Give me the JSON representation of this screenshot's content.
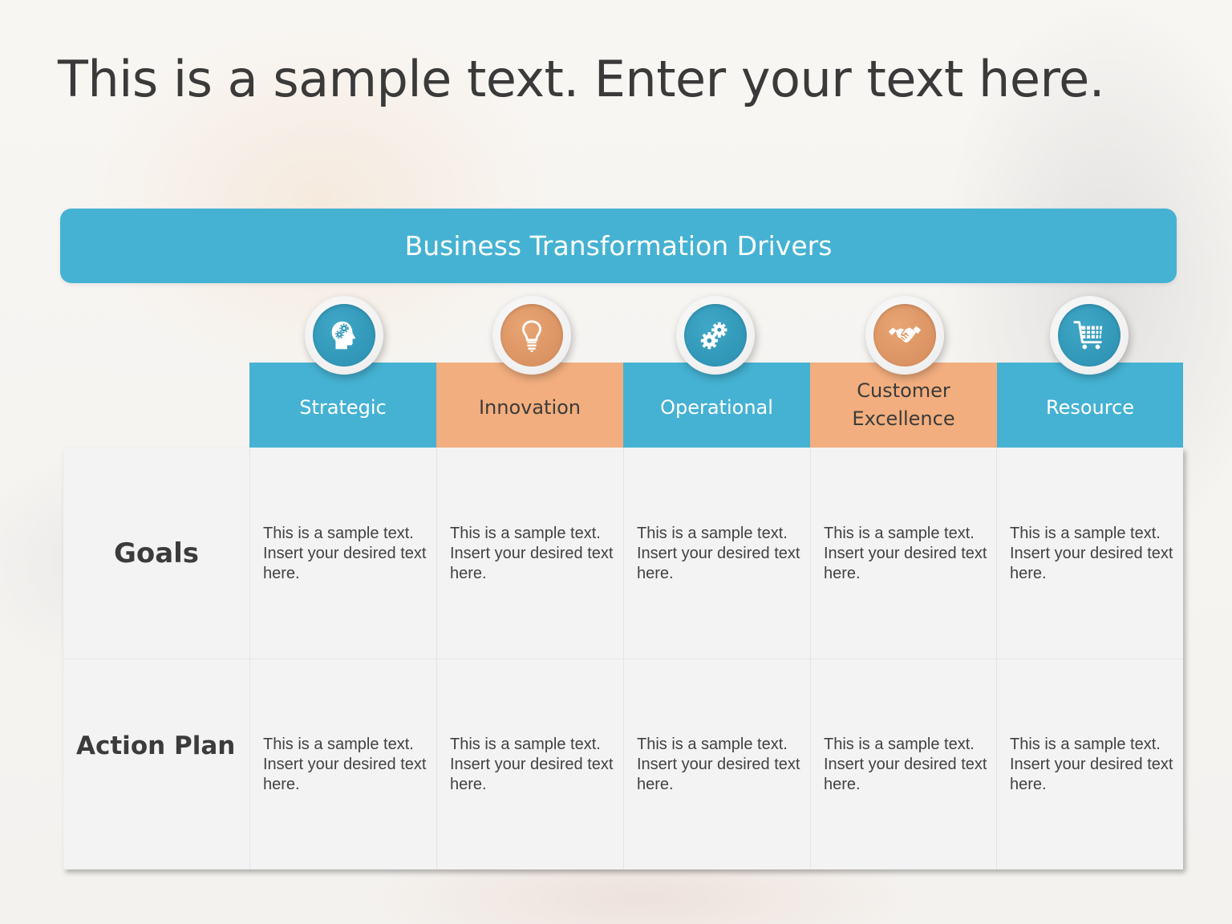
{
  "slide": {
    "title": "This is a sample text. Enter your text here.",
    "banner": "Business Transformation Drivers"
  },
  "colors": {
    "blue": "#45b2d3",
    "orange": "#f2ae7e",
    "icon_blue": "#2f97b8",
    "icon_orange": "#dd955f",
    "text_dark": "#3b3b3b",
    "cell_bg": "#f3f3f3"
  },
  "columns": [
    {
      "label": "Strategic",
      "icon": "head-gears-icon",
      "color": "blue"
    },
    {
      "label": "Innovation",
      "icon": "lightbulb-icon",
      "color": "orange"
    },
    {
      "label": "Operational",
      "icon": "gears-icon",
      "color": "blue"
    },
    {
      "label": "Customer Excellence",
      "label_line1": "Customer",
      "label_line2": "Excellence",
      "icon": "handshake-icon",
      "color": "orange"
    },
    {
      "label": "Resource",
      "icon": "shopping-cart-icon",
      "color": "blue"
    }
  ],
  "rows": [
    {
      "label": "Goals",
      "cells": [
        "This is a sample text. Insert your desired text here.",
        "This is a sample text. Insert your desired text here.",
        "This is a sample text. Insert your desired text here.",
        "This is a sample text. Insert your desired text here.",
        "This is a sample text. Insert your desired text here."
      ]
    },
    {
      "label": "Action Plan",
      "cells": [
        "This is a sample text. Insert your desired text here.",
        "This is a sample text. Insert your desired text here.",
        "This is a sample text. Insert your desired text here.",
        "This is a sample text. Insert your desired text here.",
        "This is a sample text. Insert your desired text here."
      ]
    }
  ]
}
